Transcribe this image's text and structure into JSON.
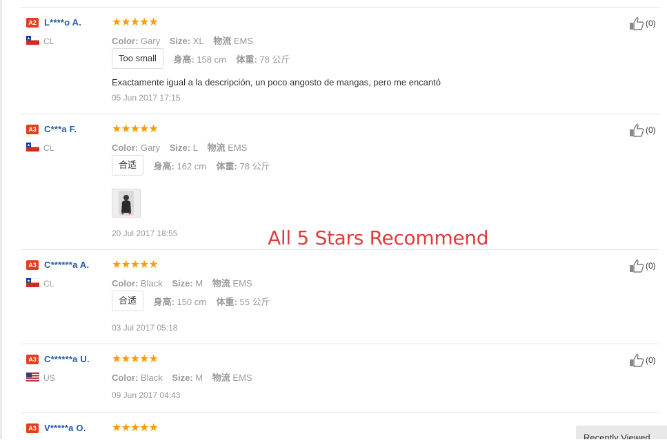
{
  "colors": {
    "star": "#ff9a00",
    "name": "#1e5aa8",
    "rank_badge": "#e0401b",
    "overlay_text": "#e03b3b"
  },
  "labels": {
    "color": "Color:",
    "size": "Size:",
    "logistics": "物流",
    "height": "身高:",
    "weight": "体重:"
  },
  "reviews": [
    {
      "rank": "A2",
      "name": "L****o A.",
      "country": "CL",
      "flag": "chile-flag-icon",
      "stars": "★★★★★",
      "color": "Gary",
      "size": "XL",
      "logistics": "EMS",
      "fit": "Too small",
      "height": "158 cm",
      "weight": "78 公斤",
      "text": "Exactamente igual a la descripción, un poco angosto de mangas, pero me encantó",
      "date": "05 Jun 2017 17:15",
      "helpful": "(0)"
    },
    {
      "rank": "A3",
      "name": "C***a F.",
      "country": "CL",
      "flag": "chile-flag-icon",
      "stars": "★★★★★",
      "color": "Gary",
      "size": "L",
      "logistics": "EMS",
      "fit": "合适",
      "height": "162 cm",
      "weight": "78 公斤",
      "date": "20 Jul 2017 18:55",
      "helpful": "(0)"
    },
    {
      "rank": "A3",
      "name": "C******a A.",
      "country": "CL",
      "flag": "chile-flag-icon",
      "stars": "★★★★★",
      "color": "Black",
      "size": "M",
      "logistics": "EMS",
      "fit": "合适",
      "height": "150 cm",
      "weight": "55 公斤",
      "date": "03 Jul 2017 05:18",
      "helpful": "(0)"
    },
    {
      "rank": "A3",
      "name": "C******a U.",
      "country": "US",
      "flag": "us-flag-icon",
      "stars": "★★★★★",
      "color": "Black",
      "size": "M",
      "logistics": "EMS",
      "date": "09 Jun 2017 04:43",
      "helpful": "(0)"
    },
    {
      "rank": "A3",
      "name": "V*****a O.",
      "stars": "★★★★★"
    }
  ],
  "overlay": "All 5 Stars Recommend",
  "recently_viewed": "Recently Viewed"
}
